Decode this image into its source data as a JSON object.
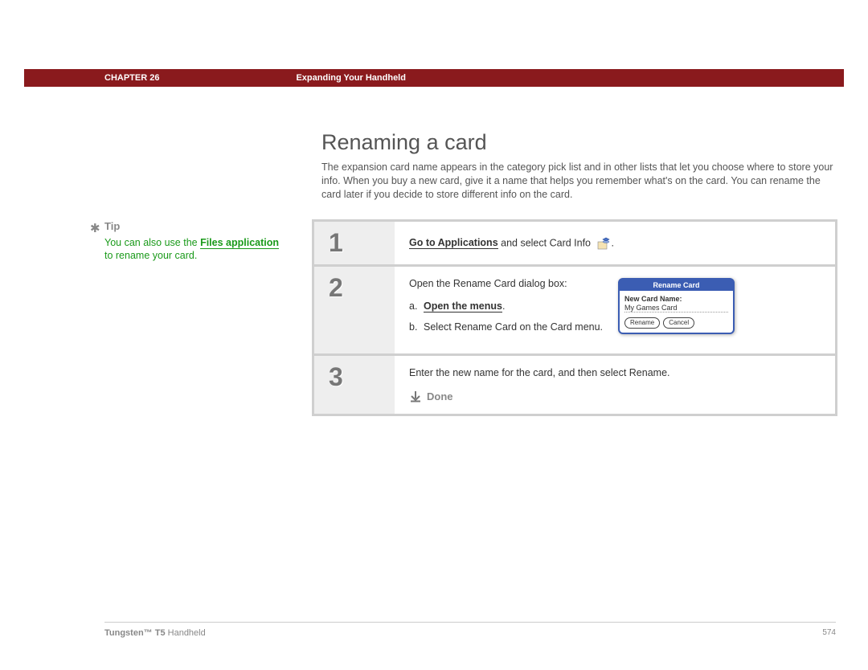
{
  "header": {
    "chapter": "CHAPTER 26",
    "section": "Expanding Your Handheld"
  },
  "page_title": "Renaming a card",
  "intro": "The expansion card name appears in the category pick list and in other lists that let you choose where to store your info. When you buy a new card, give it a name that helps you remember what's on the card. You can rename the card later if you decide to store different info on the card.",
  "tip": {
    "label": "Tip",
    "text_pre": "You can also use the ",
    "link": "Files application",
    "text_post": " to rename your card."
  },
  "steps": {
    "s1": {
      "num": "1",
      "link": "Go to Applications",
      "rest": " and select Card Info ",
      "trail": "."
    },
    "s2": {
      "num": "2",
      "lead": "Open the Rename Card dialog box:",
      "a_label": "a.",
      "a_link": "Open the menus",
      "a_trail": ".",
      "b_label": "b.",
      "b_text": "Select Rename Card on the Card menu."
    },
    "s3": {
      "num": "3",
      "text": "Enter the new name for the card, and then select Rename.",
      "done": "Done"
    }
  },
  "dialog": {
    "title": "Rename Card",
    "field_label": "New Card Name:",
    "field_value": "My Games Card",
    "btn_rename": "Rename",
    "btn_cancel": "Cancel"
  },
  "footer": {
    "product_bold": "Tungsten™ T5",
    "product_rest": " Handheld",
    "page": "574"
  }
}
